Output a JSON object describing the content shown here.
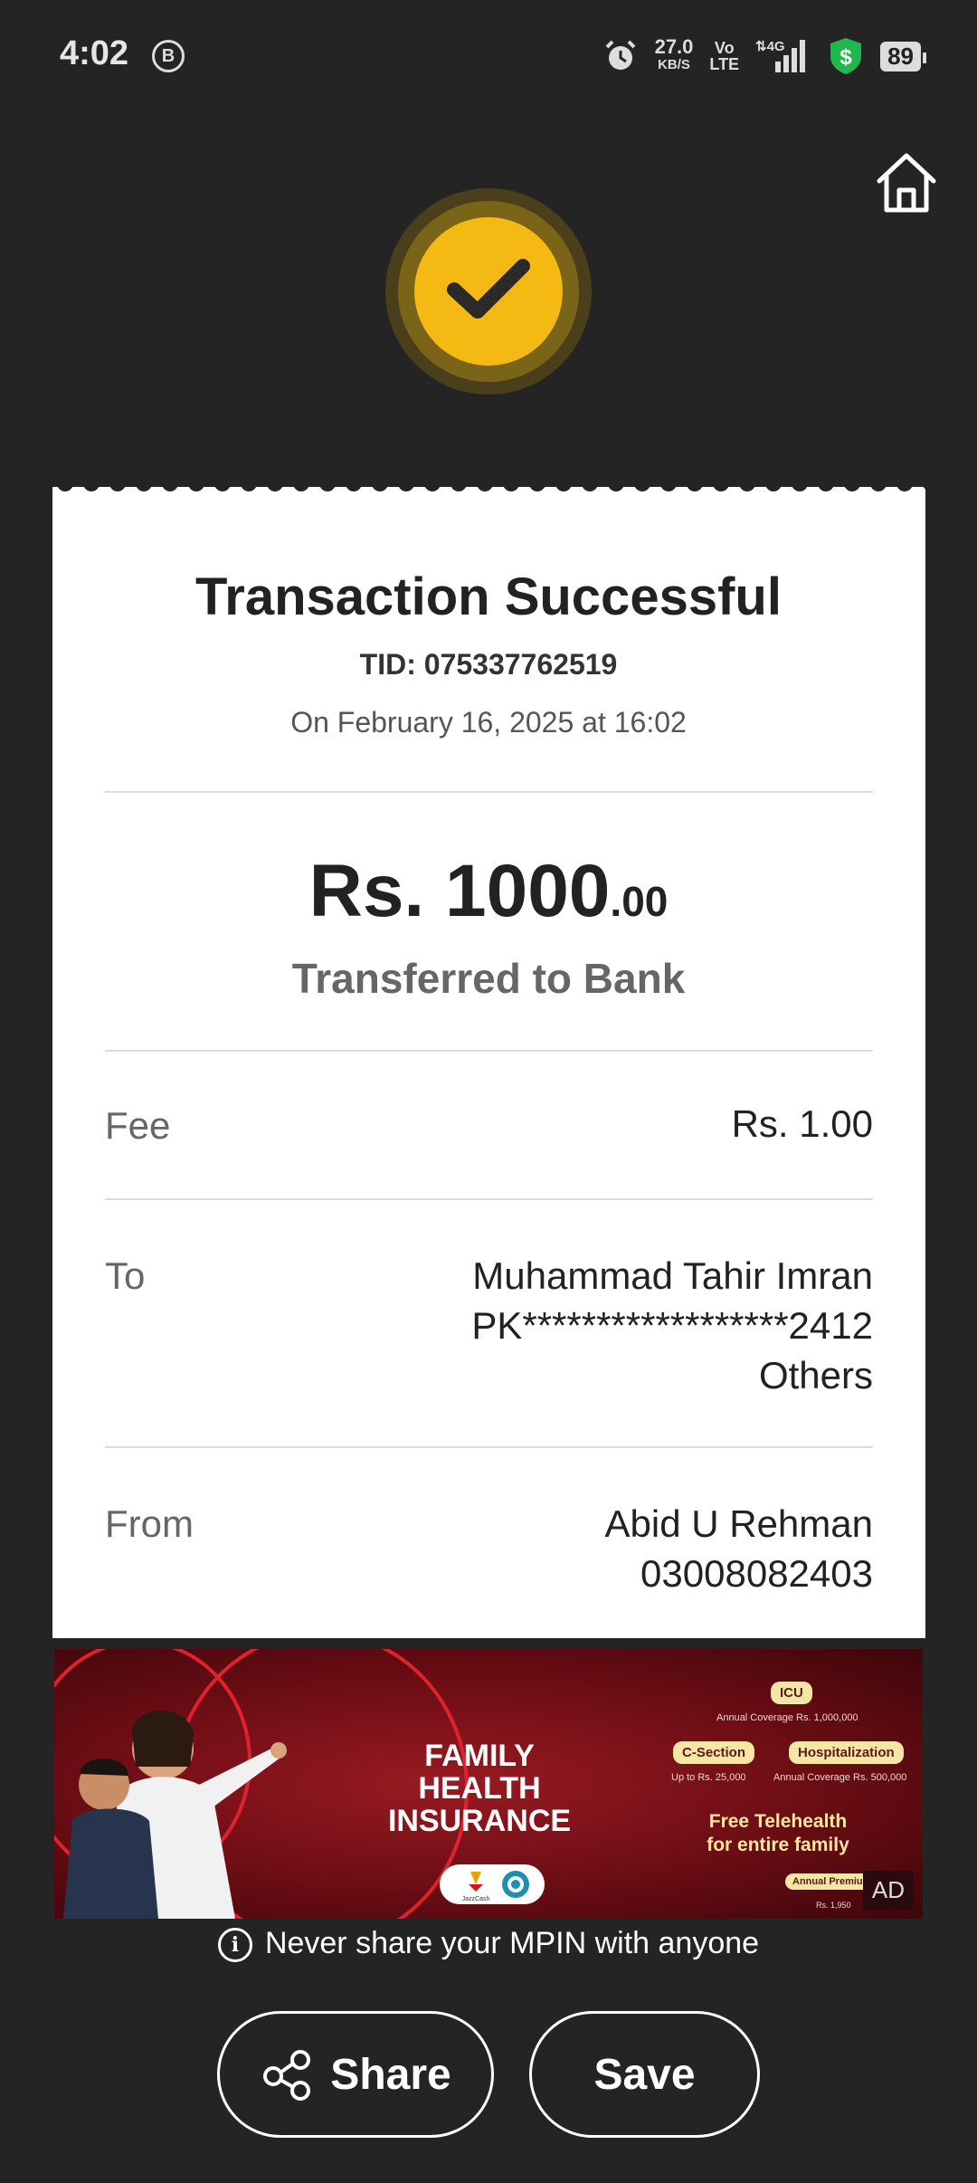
{
  "status_bar": {
    "time": "4:02",
    "b_badge": "B",
    "net_speed": "27.0",
    "net_unit": "KB/S",
    "volte_top": "Vo",
    "volte_bottom": "LTE",
    "network": "4G",
    "battery": "89"
  },
  "receipt": {
    "title": "Transaction Successful",
    "tid": "TID: 075337762519",
    "datetime": "On February 16, 2025 at 16:02",
    "amount_main": "Rs. 1000",
    "amount_decimal": ".00",
    "amount_desc": "Transferred to Bank",
    "fee": {
      "label": "Fee",
      "value": "Rs. 1.00"
    },
    "to": {
      "label": "To",
      "name": "Muhammad Tahir Imran",
      "account": "PK******************2412",
      "type": "Others"
    },
    "from": {
      "label": "From",
      "name": "Abid U Rehman",
      "number": "03008082403"
    }
  },
  "ad": {
    "title_line1": "FAMILY",
    "title_line2": "HEALTH INSURANCE",
    "pill_icu": "ICU",
    "icu_coverage": "Annual Coverage Rs. 1,000,000",
    "pill_csection": "C-Section",
    "csection_coverage": "Up to Rs. 25,000",
    "pill_hospital": "Hospitalization",
    "hospital_coverage": "Annual Coverage Rs. 500,000",
    "telehealth_1": "Free Telehealth",
    "telehealth_2": "for entire family",
    "pill_premium": "Annual Premium",
    "premium_value": "Rs. 1,950",
    "logo_text": "JazzCash",
    "tag": "AD"
  },
  "warning": "Never share your MPIN with anyone",
  "buttons": {
    "share": "Share",
    "save": "Save"
  },
  "colors": {
    "accent": "#f5b914",
    "background": "#242424"
  }
}
